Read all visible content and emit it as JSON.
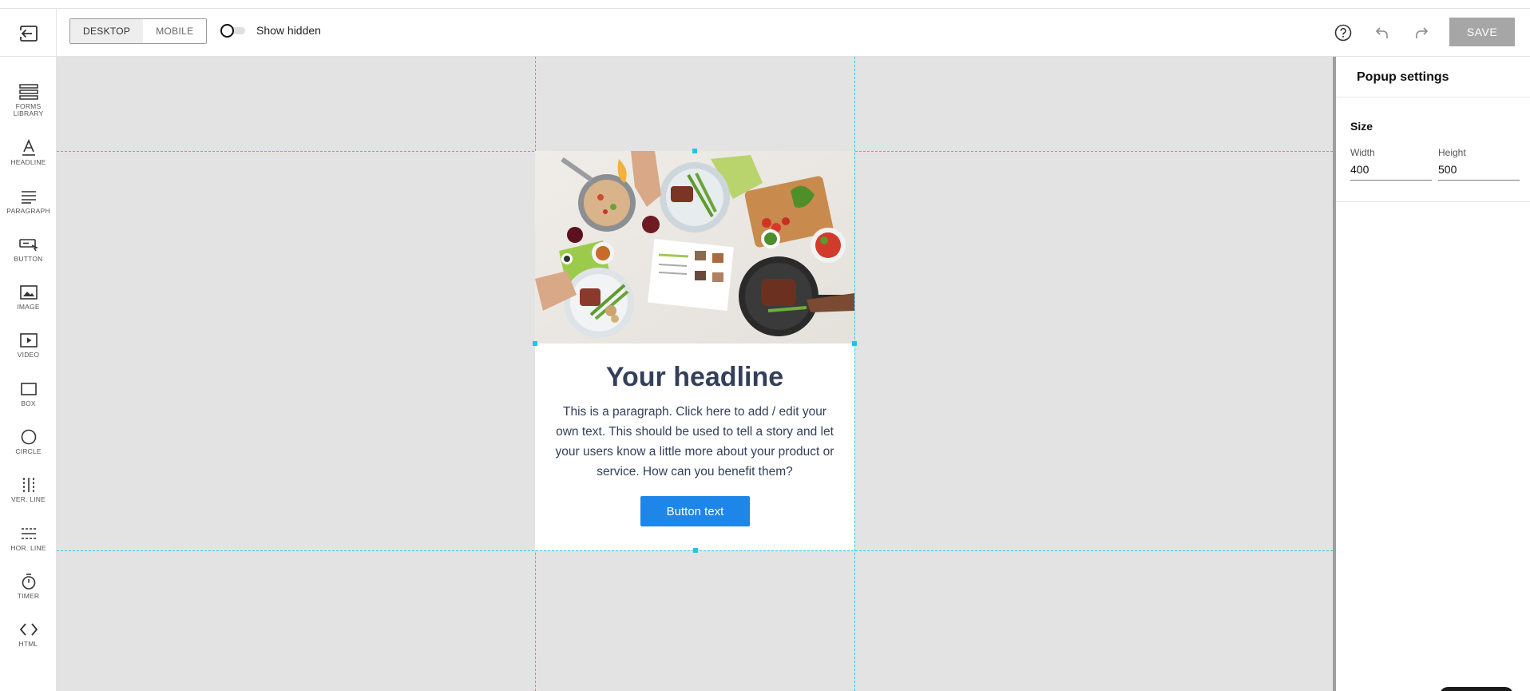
{
  "topbar": {
    "device_options": [
      "DESKTOP",
      "MOBILE"
    ],
    "active_device": "DESKTOP",
    "show_hidden_label": "Show hidden",
    "save_label": "SAVE",
    "icons": [
      "exit-editor-icon",
      "help-icon",
      "undo-icon",
      "redo-icon"
    ]
  },
  "sidebar": {
    "tools": [
      {
        "label": "FORMS LIBRARY",
        "icon": "forms-library-icon"
      },
      {
        "label": "HEADLINE",
        "icon": "headline-icon"
      },
      {
        "label": "PARAGRAPH",
        "icon": "paragraph-icon"
      },
      {
        "label": "BUTTON",
        "icon": "button-icon"
      },
      {
        "label": "IMAGE",
        "icon": "image-icon"
      },
      {
        "label": "VIDEO",
        "icon": "video-icon"
      },
      {
        "label": "BOX",
        "icon": "box-icon"
      },
      {
        "label": "CIRCLE",
        "icon": "circle-icon"
      },
      {
        "label": "VER. LINE",
        "icon": "vertical-line-icon"
      },
      {
        "label": "HOR. LINE",
        "icon": "horizontal-line-icon"
      },
      {
        "label": "TIMER",
        "icon": "timer-icon"
      },
      {
        "label": "HTML",
        "icon": "html-icon"
      }
    ]
  },
  "popup": {
    "headline": "Your headline",
    "paragraph": "This is a paragraph. Click here to add / edit your own text. This should be used to tell a story and let your users know a little more about your product or service. How can you benefit them?",
    "button_text": "Button text"
  },
  "settings": {
    "title": "Popup settings",
    "size_label": "Size",
    "width_label": "Width",
    "width_value": "400",
    "height_label": "Height",
    "height_value": "500"
  },
  "colors": {
    "canvas_bg": "#e3e3e3",
    "guide": "#25c9e6",
    "headline": "#34405a",
    "cta": "#1d86e8",
    "save_disabled": "#a6a6a6"
  }
}
